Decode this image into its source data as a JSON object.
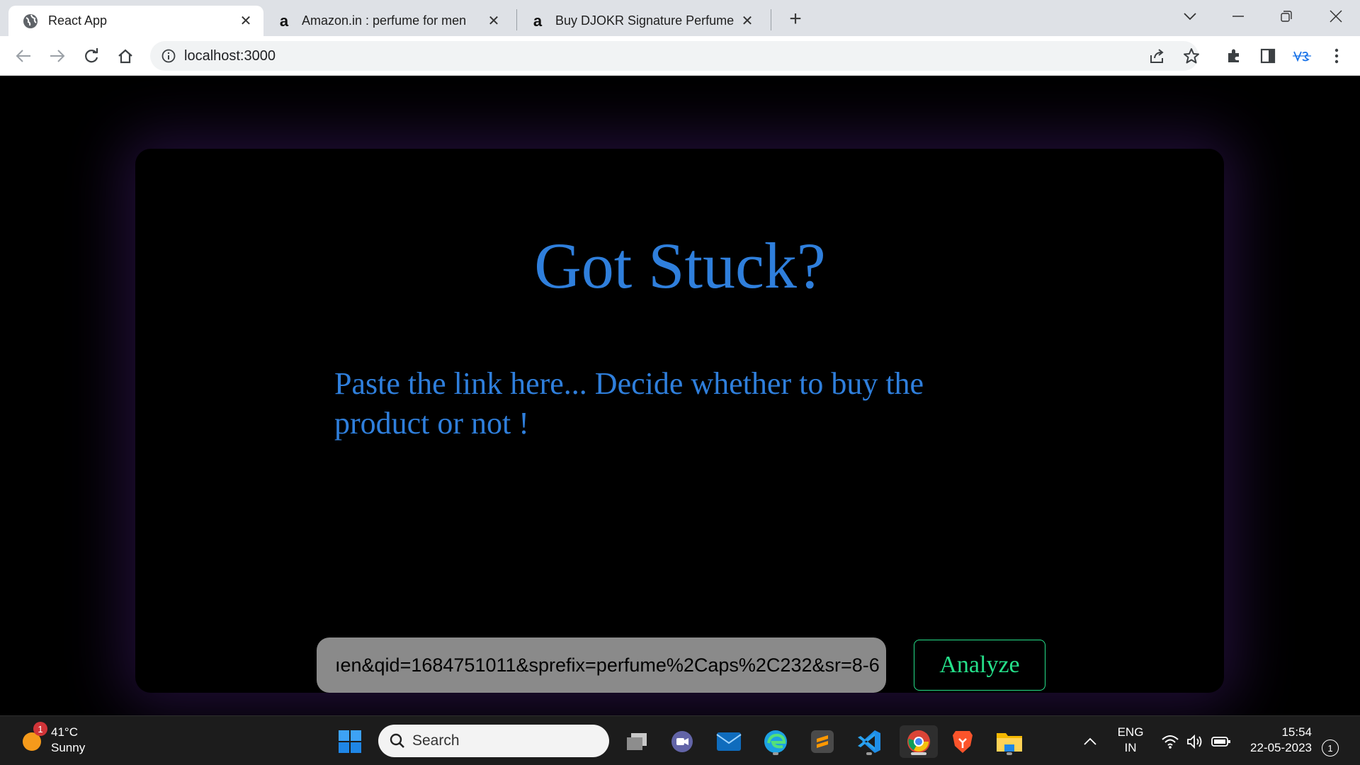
{
  "browser": {
    "tabs": [
      {
        "title": "React App",
        "icon": "globe-icon"
      },
      {
        "title": "Amazon.in : perfume for men",
        "icon": "amazon-icon"
      },
      {
        "title": "Buy DJOKR Signature Perfume Fo",
        "icon": "amazon-icon"
      }
    ],
    "amazon_glyph": "a",
    "new_tab": "+",
    "url": "localhost:3000"
  },
  "page": {
    "headline": "Got Stuck?",
    "subline": "Paste the link here... Decide whether to buy the product or not !",
    "link_value": "ıen&qid=1684751011&sprefix=perfume%2Caps%2C232&sr=8-6",
    "analyze_label": "Analyze",
    "colors": {
      "heading": "#2f7fdc",
      "button": "#25e08a",
      "input_bg": "#8a8a8a"
    }
  },
  "taskbar": {
    "weather_temp": "41°C",
    "weather_desc": "Sunny",
    "weather_badge": "1",
    "search_placeholder": "Search",
    "lang_top": "ENG",
    "lang_bottom": "IN",
    "time": "15:54",
    "date": "22-05-2023",
    "notifications": "1"
  }
}
